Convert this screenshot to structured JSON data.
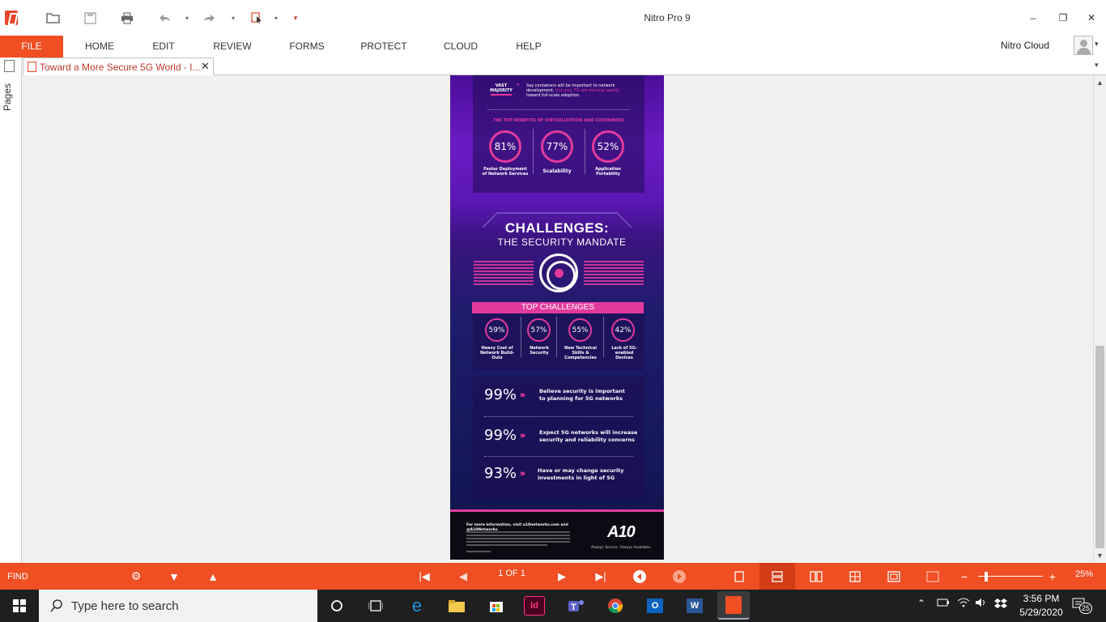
{
  "app": {
    "title": "Nitro Pro 9",
    "ribbon_tabs": [
      "FILE",
      "HOME",
      "EDIT",
      "REVIEW",
      "FORMS",
      "PROTECT",
      "CLOUD",
      "HELP"
    ],
    "cloud_user": "Nitro Cloud",
    "doc_tab": "Toward a More Secure 5G World - I...",
    "sidebar_label": "Pages",
    "window_controls": {
      "minimize": "–",
      "restore": "❐",
      "close": "✕"
    },
    "icons": [
      "open-folder-icon",
      "save-icon",
      "print-icon",
      "undo-icon",
      "redo-icon",
      "select-icon",
      "customize-icon"
    ]
  },
  "document": {
    "top_panel": {
      "stat_label": "VAST MAJORITY",
      "stat_text_a": "Say containers will be important to network development,",
      "stat_text_b": "but only 7% are moving rapidly",
      "stat_text_c": "toward full-scale adoption.",
      "benefits_heading": "THE TOP BENEFITS OF VIRTUALIZATION AND CONTAINERS",
      "benefits": [
        {
          "value": "81%",
          "label": "Faster Deployment of Network Services"
        },
        {
          "value": "77%",
          "label": "Scalability"
        },
        {
          "value": "52%",
          "label": "Application Portability"
        }
      ]
    },
    "challenges": {
      "title": "CHALLENGES:",
      "subtitle": "THE SECURITY MANDATE",
      "bar_label": "TOP CHALLENGES",
      "items": [
        {
          "value": "59%",
          "label": "Heavy Cost of Network Build-Outs"
        },
        {
          "value": "57%",
          "label": "Network Security"
        },
        {
          "value": "55%",
          "label": "New Technical Skills & Competencies"
        },
        {
          "value": "42%",
          "label": "Lack of 5G-enabled Devices"
        }
      ]
    },
    "stats": [
      {
        "value": "99%",
        "text": "Believe security is important to planning for 5G networks"
      },
      {
        "value": "99%",
        "text": "Expect 5G networks will increase security and reliability concerns"
      },
      {
        "value": "93%",
        "text": "Have or may change security investments in light of 5G"
      }
    ],
    "footer": {
      "more_info": "For more information, visit a10networks.com and @A10Networks.",
      "logo": "A10",
      "tagline": "Always Secure. Always Available."
    }
  },
  "statusbar": {
    "find_label": "FIND",
    "page_indicator": "1 OF 1",
    "zoom": "25%",
    "zoom_minus": "−",
    "zoom_plus": "+"
  },
  "taskbar": {
    "search_placeholder": "Type here to search",
    "apps": [
      "task-view",
      "edge",
      "file-explorer",
      "store",
      "indesign",
      "teams",
      "chrome",
      "outlook",
      "word",
      "nitro"
    ],
    "indesign_label": "Id",
    "outlook_label": "O",
    "word_label": "W",
    "time": "3:56 PM",
    "date": "5/29/2020",
    "notifications": "25"
  },
  "colors": {
    "accent": "#f04e23",
    "magenta": "#e23a9c",
    "taskbar": "#1f1f1f"
  }
}
